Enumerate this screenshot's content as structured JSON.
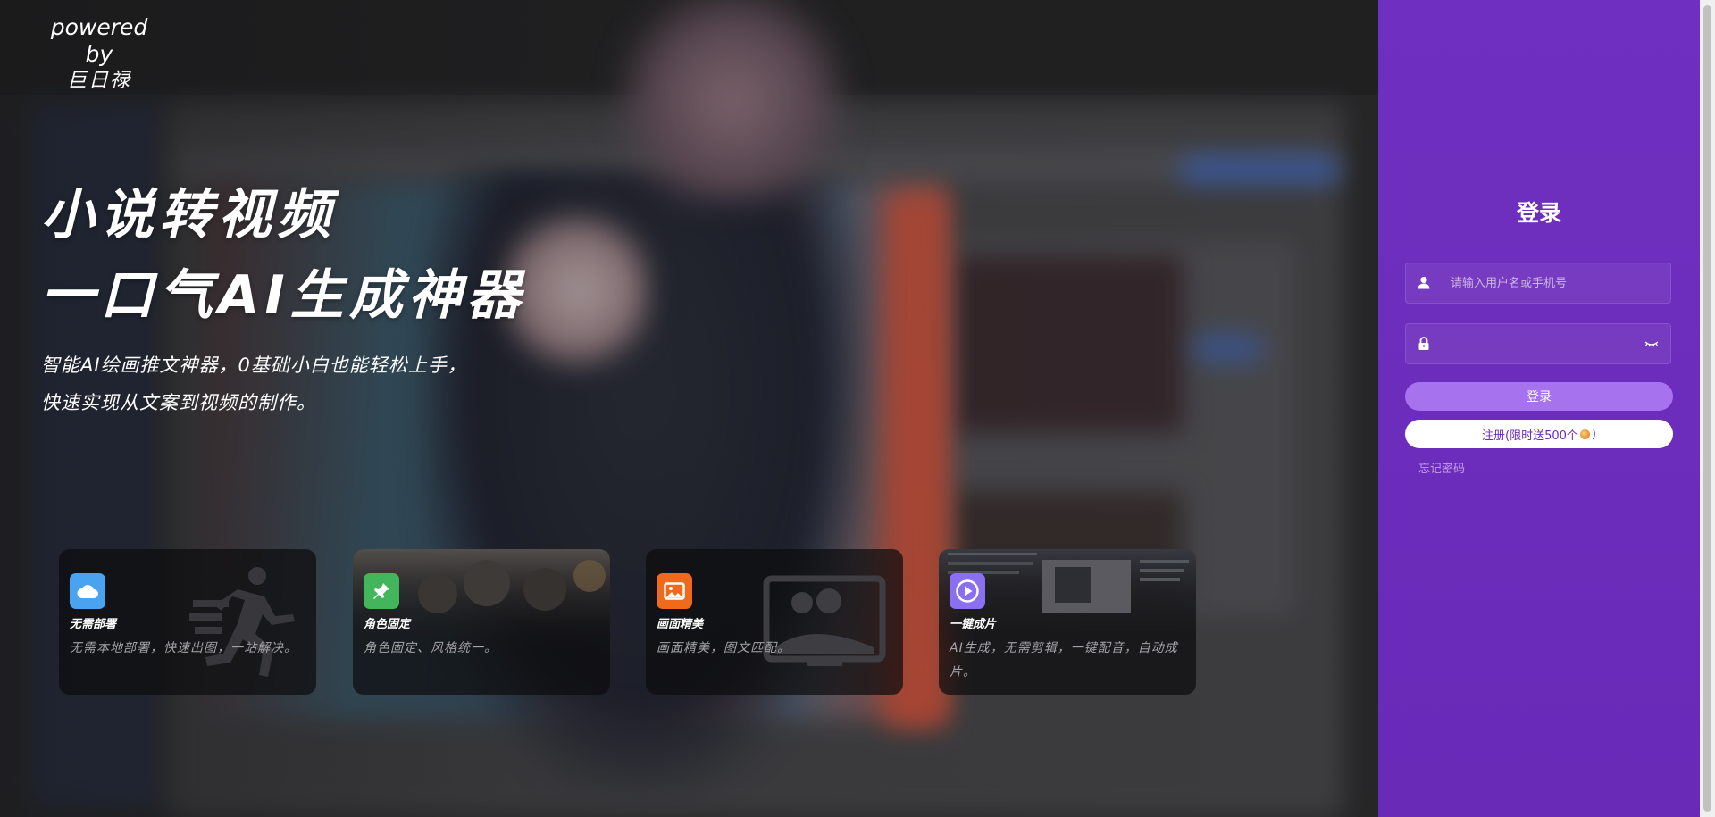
{
  "brand": {
    "line1": "powered by",
    "line2": "巨日禄"
  },
  "hero": {
    "title_line1": "小说转视频",
    "title_line2": "一口气AI生成神器",
    "subtitle_line1": "智能AI绘画推文神器，0基础小白也能轻松上手，",
    "subtitle_line2": "快速实现从文案到视频的制作。"
  },
  "features": [
    {
      "title": "无需部署",
      "desc": "无需本地部署，快速出图，一站解决。",
      "icon": "cloud-icon",
      "color": "#4aa3f0"
    },
    {
      "title": "角色固定",
      "desc": "角色固定、风格统一。",
      "icon": "pin-icon",
      "color": "#43b55a"
    },
    {
      "title": "画面精美",
      "desc": "画面精美，图文匹配。",
      "icon": "image-icon",
      "color": "#f06a1e"
    },
    {
      "title": "一键成片",
      "desc": "AI生成，无需剪辑，一键配音，自动成片。",
      "icon": "play-icon",
      "color": "#8a6ff0"
    }
  ],
  "login": {
    "title": "登录",
    "username_placeholder": "请输入用户名或手机号",
    "password_value": "",
    "login_button": "登录",
    "register_prefix": "注册(限时送500个",
    "register_suffix": ")",
    "forgot": "忘记密码"
  },
  "colors": {
    "panel": "#6f2fc0",
    "login_button": "#a772ee",
    "register_text": "#6b2bb9",
    "forgot_text": "#c79df0"
  }
}
